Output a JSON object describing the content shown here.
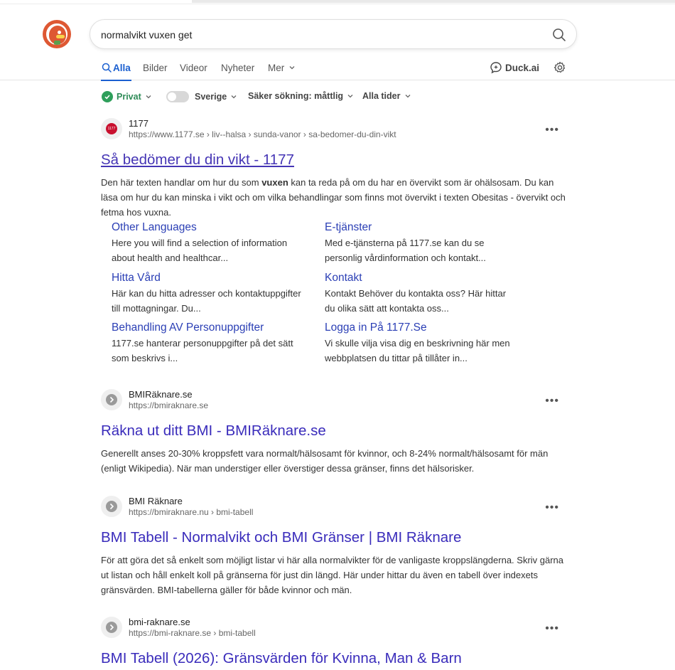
{
  "search": {
    "query": "normalvikt vuxen get"
  },
  "tabs": [
    {
      "label": "Alla"
    },
    {
      "label": "Bilder"
    },
    {
      "label": "Videor"
    },
    {
      "label": "Nyheter"
    },
    {
      "label": "Mer"
    }
  ],
  "duckai_label": "Duck.ai",
  "filters": {
    "privat": "Privat",
    "region": "Sverige",
    "safe": "Säker sökning: måttlig",
    "time": "Alla tider"
  },
  "results": [
    {
      "site_name": "1177",
      "url": "https://www.1177.se › liv--halsa › sunda-vanor › sa-bedomer-du-din-vikt",
      "title": "Så bedömer du din vikt - 1177",
      "snippet_before": "Den här texten handlar om hur du som ",
      "snippet_bold": "vuxen",
      "snippet_after": " kan ta reda på om du har en övervikt som är ohälsosam. Du kan läsa om hur du kan minska i vikt och om vilka behandlingar som finns mot övervikt i texten Obesitas - övervikt och fetma hos vuxna.",
      "favicon_text": "1177"
    },
    {
      "site_name": "BMIRäknare.se",
      "url": "https://bmiraknare.se",
      "title": "Räkna ut ditt BMI - BMIRäknare.se",
      "snippet": "Generellt anses 20-30% kroppsfett vara normalt/hälsosamt för kvinnor, och 8-24% normalt/hälsosamt för män (enligt Wikipedia). När man understiger eller överstiger dessa gränser, finns det hälsorisker."
    },
    {
      "site_name": "BMI Räknare",
      "url": "https://bmiraknare.nu › bmi-tabell",
      "title": "BMI Tabell - Normalvikt och BMI Gränser | BMI Räknare",
      "snippet": "För att göra det så enkelt som möjligt listar vi här alla normalvikter för de vanligaste kroppslängderna. Skriv gärna ut listan och håll enkelt koll på gränserna för just din längd. Här under hittar du även en tabell över indexets gränsvärden. BMI-tabellerna gäller för både kvinnor och män."
    },
    {
      "site_name": "bmi-raknare.se",
      "url": "https://bmi-raknare.se › bmi-tabell",
      "title": "BMI Tabell (2026): Gränsvärden för Kvinna, Man & Barn"
    }
  ],
  "sitelinks": [
    {
      "title": "Other Languages",
      "desc": "Here you will find a selection of information about health and healthcar..."
    },
    {
      "title": "E-tjänster",
      "desc": "Med e-tjänsterna på 1177.se kan du se personlig vårdinformation och kontakt..."
    },
    {
      "title": "Hitta Vård",
      "desc": "Här kan du hitta adresser och kontaktuppgifter till mottagningar. Du..."
    },
    {
      "title": "Kontakt",
      "desc": "Kontakt Behöver du kontakta oss? Här hittar du olika sätt att kontakta oss..."
    },
    {
      "title": "Behandling AV Personuppgifter",
      "desc": "1177.se hanterar personuppgifter på det sätt som beskrivs i..."
    },
    {
      "title": "Logga in På 1177.Se",
      "desc": "Vi skulle vilja visa dig en beskrivning här men webbplatsen du tittar på tillåter in..."
    }
  ],
  "icons": {
    "search": "search-icon",
    "duckai": "duckai-icon",
    "settings": "gear-icon",
    "more": "more-options-icon"
  },
  "colors": {
    "accent": "#1a5fd0",
    "title_link": "#3a2cbb",
    "private_green": "#2e9f5b",
    "logo": "#de5833"
  }
}
